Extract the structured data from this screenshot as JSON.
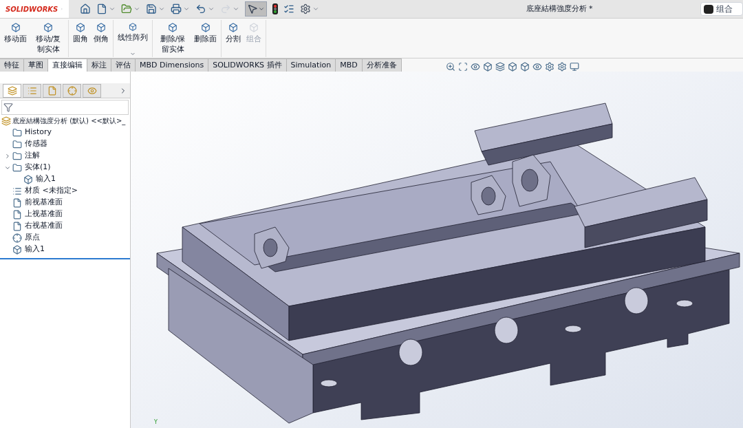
{
  "app": {
    "logo": "SOLIDWORKS",
    "title": "底座結構強度分析 *",
    "search": {
      "value": "组合"
    }
  },
  "ribbon": {
    "groups": [
      [
        {
          "label": "移动面",
          "disabled": false
        },
        {
          "label": "移动/复制实体",
          "disabled": false
        }
      ],
      [
        {
          "label": "圆角",
          "disabled": false
        },
        {
          "label": "倒角",
          "disabled": false
        }
      ],
      [
        {
          "label": "线性阵列",
          "disabled": false,
          "dropdown": true
        }
      ],
      [
        {
          "label": "删除/保留实体",
          "disabled": false
        },
        {
          "label": "删除面",
          "disabled": false
        }
      ],
      [
        {
          "label": "分割",
          "disabled": false
        },
        {
          "label": "组合",
          "disabled": true
        }
      ]
    ]
  },
  "tabs": [
    {
      "label": "特征",
      "selected": false
    },
    {
      "label": "草图",
      "selected": false
    },
    {
      "label": "直接编辑",
      "selected": true
    },
    {
      "label": "标注",
      "selected": false
    },
    {
      "label": "评估",
      "selected": false
    },
    {
      "label": "MBD Dimensions",
      "selected": false
    },
    {
      "label": "SOLIDWORKS 插件",
      "selected": false
    },
    {
      "label": "Simulation",
      "selected": false
    },
    {
      "label": "MBD",
      "selected": false
    },
    {
      "label": "分析准备",
      "selected": false
    }
  ],
  "panel_tabs": [
    {
      "kind": "feature",
      "selected": true
    },
    {
      "kind": "property",
      "selected": false
    },
    {
      "kind": "config",
      "selected": false
    },
    {
      "kind": "dimxpert",
      "selected": false
    },
    {
      "kind": "display",
      "selected": false
    }
  ],
  "tree": {
    "root": "底座結構強度分析 (默认) <<默认>_",
    "items": [
      {
        "label": "History",
        "kind": "history"
      },
      {
        "label": "传感器",
        "kind": "sensor"
      },
      {
        "label": "注解",
        "kind": "annotation",
        "expanded": false
      },
      {
        "label": "实体(1)",
        "kind": "solid",
        "expanded": true,
        "children": [
          {
            "label": "输入1",
            "kind": "body"
          }
        ]
      },
      {
        "label": "材质 <未指定>",
        "kind": "material"
      },
      {
        "label": "前视基准面",
        "kind": "plane"
      },
      {
        "label": "上视基准面",
        "kind": "plane"
      },
      {
        "label": "右视基准面",
        "kind": "plane"
      },
      {
        "label": "原点",
        "kind": "origin"
      },
      {
        "label": "输入1",
        "kind": "import"
      }
    ]
  },
  "viewport": {
    "triad_label": "Y"
  }
}
